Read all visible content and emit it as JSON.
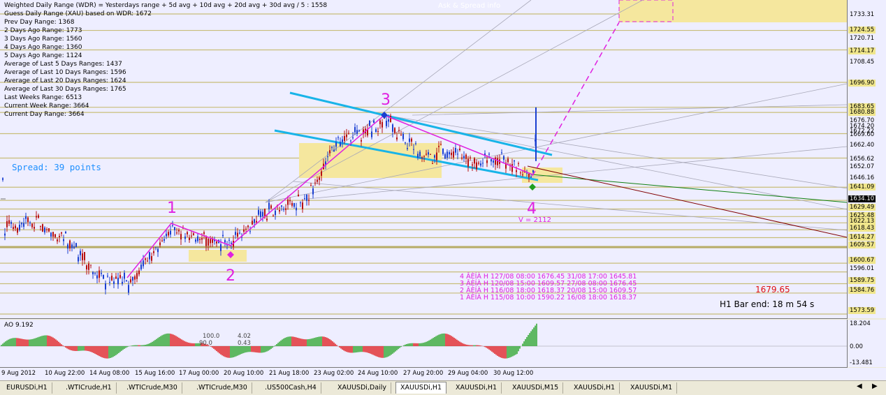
{
  "info_lines": [
    "Weighted Daily Range (WDR) = Yesterdays range + 5d avg + 10d avg + 20d avg + 30d avg / 5 : 1558",
    "Guess Daily Range (XAU) based on WDR: 1672",
    "Prev Day Range: 1368",
    "2 Days Ago Range: 1773",
    "3 Days Ago Range: 1560",
    "4 Days Ago Range: 1360",
    "5 Days Ago Range: 1124",
    "Average of Last 5 Days Ranges: 1437",
    "Average of Last 10 Days Ranges: 1596",
    "Average of Last 20 Days Ranges: 1624",
    "Average of Last 30 Days Ranges: 1765",
    "Last Weeks Range: 6513",
    "Current Week Range: 3664",
    "Current Day Range: 3664"
  ],
  "spread_text": "Spread: 39 points",
  "watermark": "Ask & Spread info",
  "wave_labels": [
    "1",
    "2",
    "3",
    "4"
  ],
  "volume_label": "V = 2112",
  "wave_table": [
    "4 ÂÈÍÀ H 127/08 08:00 1676.45 31/08 17:00 1645.81",
    "3 ÂÈÍÀ H 120/08 15:00 1609.57 27/08 08:00 1676.45",
    "2 ÂÈÍÀ H 116/08 18:00 1618.37 20/08 15:00 1609.57",
    "1 ÂÈÍÀ H 115/08 10:00 1590.22 16/08 18:00 1618.37"
  ],
  "current_price": "1679.65",
  "bar_end": "H1 Bar end: 18 m 54 s",
  "price_scale": [
    {
      "label": "1733.31",
      "style": "plain"
    },
    {
      "label": "1724.55",
      "style": "box"
    },
    {
      "label": "1720.71",
      "style": "plain"
    },
    {
      "label": "1714.17",
      "style": "box"
    },
    {
      "label": "1708.45",
      "style": "plain"
    },
    {
      "label": "1696.90",
      "style": "box"
    },
    {
      "label": "1683.65",
      "style": "box"
    },
    {
      "label": "1680.88",
      "style": "box"
    },
    {
      "label": "1676.70",
      "style": "plain"
    },
    {
      "label": "1674.20",
      "style": "plain"
    },
    {
      "label": "1672.22",
      "style": "plain"
    },
    {
      "label": "1669.60",
      "style": "plain"
    },
    {
      "label": "1662.40",
      "style": "plain"
    },
    {
      "label": "1656.62",
      "style": "plain"
    },
    {
      "label": "1652.07",
      "style": "plain"
    },
    {
      "label": "1646.16",
      "style": "plain"
    },
    {
      "label": "1641.09",
      "style": "box"
    },
    {
      "label": "1634.10",
      "style": "dark"
    },
    {
      "label": "1629.49",
      "style": "box"
    },
    {
      "label": "1625.48",
      "style": "box"
    },
    {
      "label": "1622.13",
      "style": "box"
    },
    {
      "label": "1618.43",
      "style": "box"
    },
    {
      "label": "1614.27",
      "style": "box"
    },
    {
      "label": "1609.57",
      "style": "box"
    },
    {
      "label": "1600.67",
      "style": "box"
    },
    {
      "label": "1596.01",
      "style": "plain"
    },
    {
      "label": "1589.75",
      "style": "box"
    },
    {
      "label": "1584.76",
      "style": "box"
    },
    {
      "label": "1573.59",
      "style": "box"
    }
  ],
  "ao": {
    "title": "AO 9.192",
    "levels": [
      "100.0",
      "90.0",
      "4.02",
      "0.43"
    ],
    "scale": [
      "18.204",
      "0.00",
      "-13.481"
    ]
  },
  "time_axis": [
    "9 Aug 2012",
    "10 Aug 22:00",
    "14 Aug 08:00",
    "15 Aug 16:00",
    "17 Aug 00:00",
    "20 Aug 10:00",
    "21 Aug 18:00",
    "23 Aug 02:00",
    "24 Aug 10:00",
    "27 Aug 20:00",
    "29 Aug 04:00",
    "30 Aug 12:00"
  ],
  "tabs": [
    {
      "label": "EURUSDi,H1",
      "active": false
    },
    {
      "label": ".WTICrude,H1",
      "active": false
    },
    {
      "label": ".WTICrude,M30",
      "active": false
    },
    {
      "label": ".WTICrude,M30",
      "active": false
    },
    {
      "label": ".US500Cash,H4",
      "active": false
    },
    {
      "label": "XAUUSDi,Daily",
      "active": false
    },
    {
      "label": "XAUUSDi,H1",
      "active": true
    },
    {
      "label": "XAUUSDi,H1",
      "active": false
    },
    {
      "label": "XAUUSDi,M15",
      "active": false
    },
    {
      "label": "XAUUSDi,H1",
      "active": false
    },
    {
      "label": "XAUUSDi,M1",
      "active": false
    }
  ],
  "colors": {
    "chart_bg": "#eeeeff",
    "bull_candle": "#1a3fd0",
    "bear_candle": "#b81010",
    "wave_magenta": "#e020e0",
    "channel_cyan": "#18b4e8",
    "zone_yellow": "#f5e79e",
    "ao_up": "#20a020",
    "ao_down": "#e01010"
  }
}
